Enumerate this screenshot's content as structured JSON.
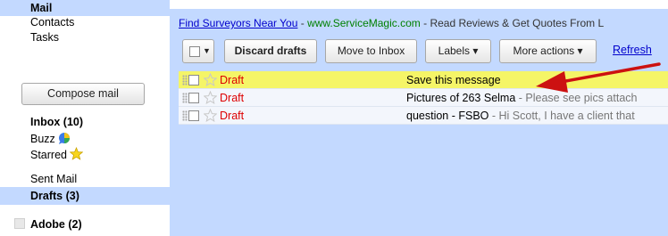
{
  "sidebar": {
    "nav_top": [
      "Mail",
      "Contacts",
      "Tasks"
    ],
    "compose_label": "Compose mail",
    "inbox": "Inbox (10)",
    "buzz": "Buzz",
    "starred": "Starred",
    "sent": "Sent Mail",
    "drafts": "Drafts (3)",
    "label_adobe": "Adobe (2)"
  },
  "ad": {
    "link": "Find Surveyors Near You",
    "sep": " - ",
    "url": "www.ServiceMagic.com",
    "text": " - Read Reviews & Get Quotes From L"
  },
  "toolbar": {
    "discard": "Discard drafts",
    "move_inbox": "Move to Inbox",
    "labels": "Labels ▾",
    "more": "More actions ▾",
    "refresh": "Refresh"
  },
  "rows": [
    {
      "label": "Draft",
      "subject": "Save this message",
      "snippet": ""
    },
    {
      "label": "Draft",
      "subject": "Pictures of 263 Selma",
      "snippet": " - Please see pics attach"
    },
    {
      "label": "Draft",
      "subject": "question - FSBO",
      "snippet": " - Hi Scott, I have a client that"
    }
  ],
  "colors": {
    "accent": "#c3d9ff",
    "highlight_row": "#f5f567",
    "draft_red": "#dd0000",
    "arrow_red": "#cc1111"
  }
}
